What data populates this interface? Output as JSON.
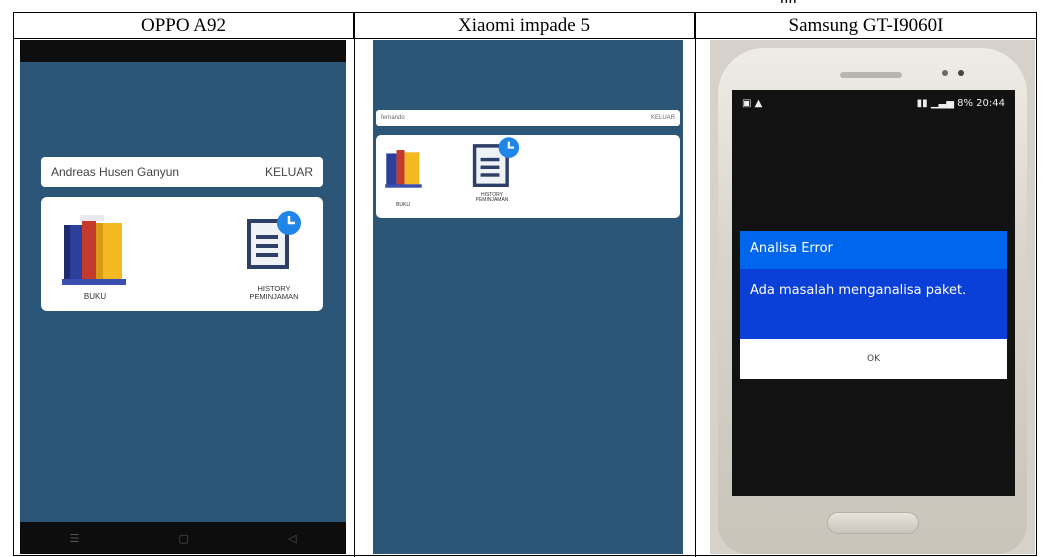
{
  "columns": [
    {
      "header": "OPPO A92"
    },
    {
      "header": "Xiaomi impade 5"
    },
    {
      "header": "Samsung GT-I9060I"
    }
  ],
  "oppo": {
    "user_name": "Andreas Husen Ganyun",
    "logout_label": "KELUAR",
    "menu": [
      {
        "label": "BUKU",
        "icon": "books-icon"
      },
      {
        "label_line1": "HISTORY",
        "label_line2": "PEMINJAMAN",
        "icon": "history-document-icon"
      }
    ],
    "nav_icons": [
      "menu-icon",
      "home-icon",
      "back-icon"
    ]
  },
  "xiaomi": {
    "user_name": "fernando",
    "logout_label": "KELUAR",
    "menu": [
      {
        "label": "BUKU",
        "icon": "books-icon"
      },
      {
        "label_line1": "HISTORY",
        "label_line2": "PEMINJAMAN",
        "icon": "history-document-icon"
      }
    ]
  },
  "samsung": {
    "status_time": "20:44",
    "status_battery": "8%",
    "brand": "SAMSUNG",
    "dialog": {
      "title": "Analisa Error",
      "message": "Ada masalah menganalisa paket.",
      "ok_label": "OK"
    }
  },
  "colors": {
    "app_background": "#2c5677",
    "dialog_title": "#0066ee",
    "dialog_body": "#0a3fd8"
  }
}
